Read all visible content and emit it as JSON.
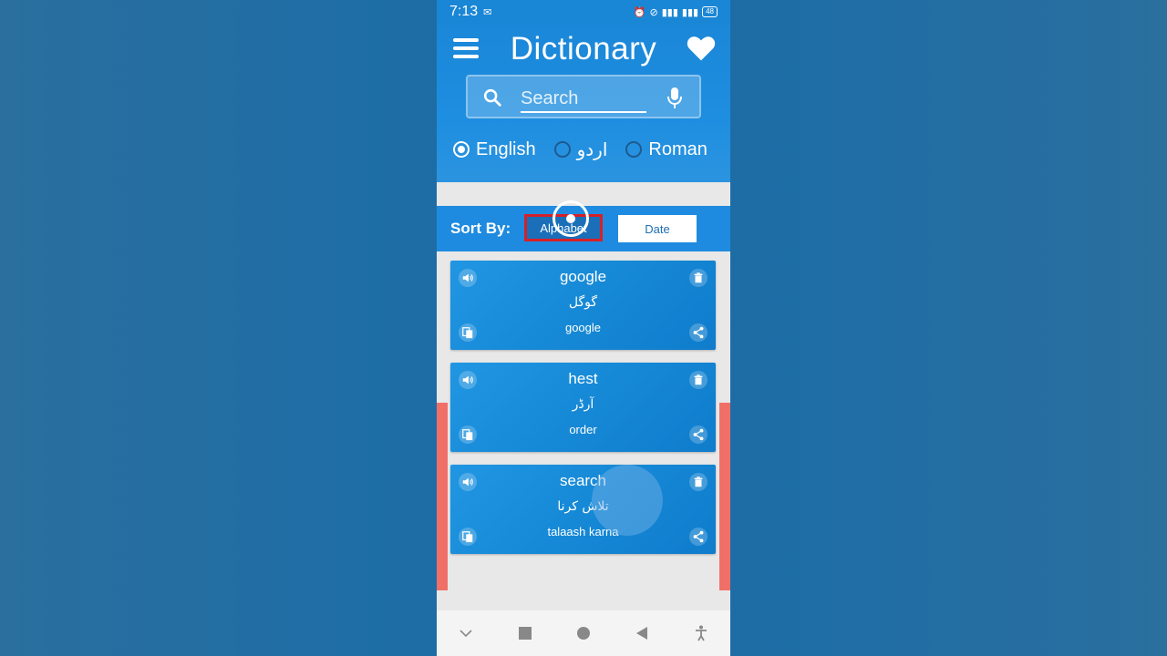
{
  "status": {
    "time": "7:13",
    "battery": "48"
  },
  "header": {
    "title": "Dictionary"
  },
  "search": {
    "placeholder": "Search"
  },
  "languages": [
    {
      "label": "English",
      "checked": true
    },
    {
      "label": "اردو",
      "checked": false
    },
    {
      "label": "Roman",
      "checked": false
    }
  ],
  "sort": {
    "label": "Sort By:",
    "alphabet": "Alphabet",
    "date": "Date"
  },
  "entries": [
    {
      "word": "google",
      "urdu": "گوگل",
      "roman": "google"
    },
    {
      "word": "hest",
      "urdu": "آرڈر",
      "roman": "order"
    },
    {
      "word": "search",
      "urdu": "تلاش کرنا",
      "roman": "talaash karna"
    }
  ],
  "colors": {
    "primary": "#1e8be0",
    "selected_border": "#d62027",
    "accent_side": "#f07068"
  }
}
